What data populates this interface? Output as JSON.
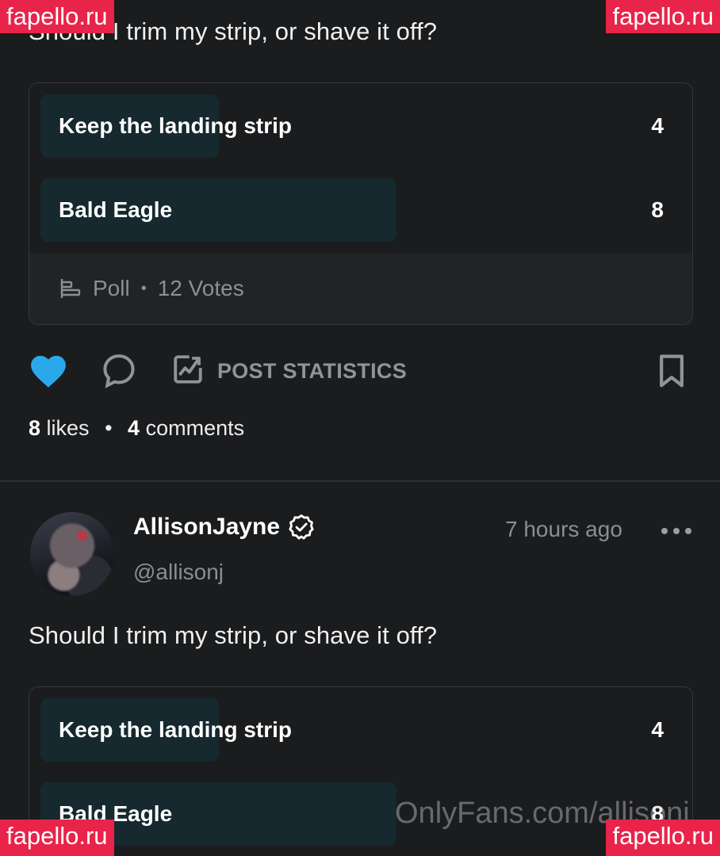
{
  "post1": {
    "text": "Should I trim my strip, or shave it off?",
    "poll": {
      "options": [
        {
          "label": "Keep the landing strip",
          "count": "4",
          "fraction": 0.333
        },
        {
          "label": "Bald Eagle",
          "count": "8",
          "fraction": 0.667
        }
      ],
      "footer_type": "Poll",
      "footer_votes": "12 Votes"
    },
    "actions": {
      "statistics_label": "POST STATISTICS",
      "liked": true,
      "like_color": "#29a9ea"
    },
    "likes_count": "8",
    "likes_word": "likes",
    "comments_count": "4",
    "comments_word": "comments"
  },
  "post2": {
    "author_name": "AllisonJayne",
    "author_handle": "@allisonj",
    "timestamp": "7 hours ago",
    "text": "Should I trim my strip, or shave it off?",
    "poll": {
      "options": [
        {
          "label": "Keep the landing strip",
          "count": "4",
          "fraction": 0.333
        },
        {
          "label": "Bald Eagle",
          "count": "8",
          "fraction": 0.667
        }
      ]
    }
  },
  "watermarks": {
    "site": "fapello.ru",
    "onlyfans": "OnlyFans.com/allisonj"
  },
  "colors": {
    "background": "#1b1c1e",
    "poll_fill": "#15292f",
    "badge": "#e8244a",
    "muted": "#8a8e94"
  },
  "icons": {
    "like": "heart-icon",
    "comment": "comment-bubble-icon",
    "stats": "chart-image-icon",
    "bookmark": "bookmark-icon",
    "poll": "poll-bars-icon",
    "verified": "verified-badge-icon",
    "more": "more-dots-icon"
  }
}
